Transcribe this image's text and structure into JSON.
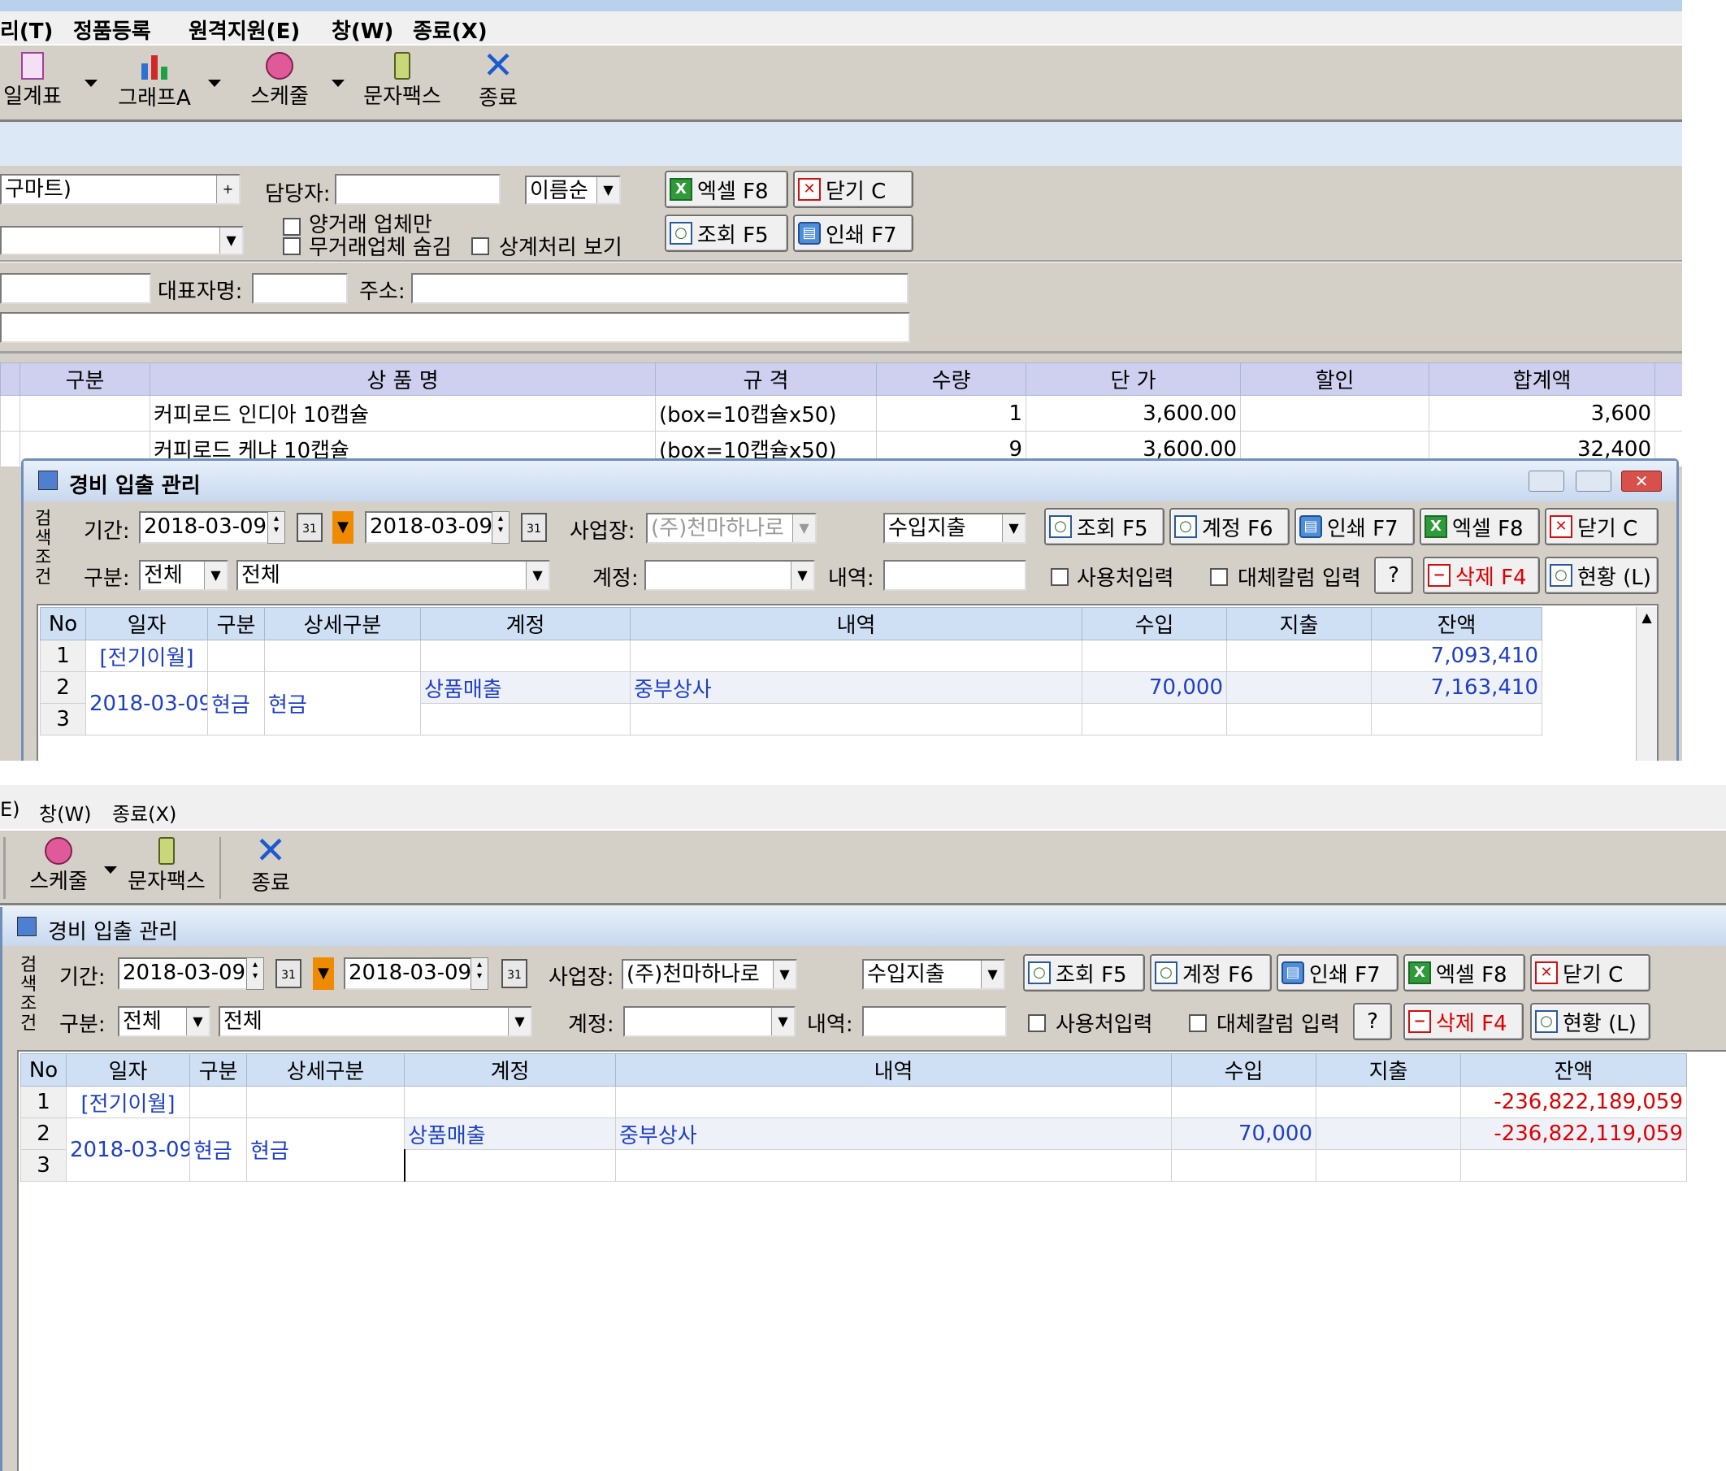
{
  "top": {
    "menu": [
      "리(T)",
      "정품등록",
      "원격지원(E)",
      "창(W)",
      "종료(X)"
    ],
    "toolbar": [
      {
        "label": "일계표",
        "icon": "ledger-icon"
      },
      {
        "label": "그래프A",
        "icon": "bar-chart-icon"
      },
      {
        "label": "스케줄",
        "icon": "clock-icon"
      },
      {
        "label": "문자팩스",
        "icon": "phone-icon"
      },
      {
        "label": "종료",
        "icon": "exit-x-icon"
      }
    ],
    "filter": {
      "store_value": "구마트)",
      "manager_label": "담당자:",
      "manager_value": "",
      "sort_value": "이름순",
      "only_traded_label": "양거래 업체만",
      "hide_untraded_label": "무거래업체 숨김",
      "offset_label": "상계처리 보기",
      "excel_btn": "엑셀 F8",
      "close_btn": "닫기 C",
      "search_btn": "조회 F5",
      "print_btn": "인쇄 F7",
      "rep_label": "대표자명:",
      "addr_label": "주소:"
    },
    "grid": {
      "headers": [
        "구분",
        "상 품 명",
        "규 격",
        "수량",
        "단 가",
        "할인",
        "합계액"
      ],
      "rows": [
        [
          "",
          "커피로드 인디아 10캡슐",
          "(box=10캡슐x50)",
          "1",
          "3,600.00",
          "",
          "3,600"
        ],
        [
          "",
          "커피로드 케냐 10캡슐",
          "(box=10캡슐x50)",
          "9",
          "3,600.00",
          "",
          "32,400"
        ]
      ]
    }
  },
  "dialog1": {
    "title": "경비 입출 관리",
    "side_label": "검색조건",
    "period_label": "기간:",
    "date_from": "2018-03-09",
    "date_to": "2018-03-09",
    "cal_label": "31",
    "biz_label": "사업장:",
    "biz_value": "(주)천마하나로",
    "io_value": "수입지출",
    "btn_search": "조회 F5",
    "btn_account": "계정 F6",
    "btn_print": "인쇄 F7",
    "btn_excel": "엑셀 F8",
    "btn_close": "닫기 C",
    "type_label": "구분:",
    "type_value": "전체",
    "type2_value": "전체",
    "acct_label": "계정:",
    "acct_value": "",
    "detail_label": "내역:",
    "detail_value": "",
    "use_label": "사용처입력",
    "alt_label": "대체칼럼 입력",
    "help_btn": "?",
    "btn_delete": "삭제 F4",
    "btn_status": "현황 (L)",
    "headers": [
      "No",
      "일자",
      "구분",
      "상세구분",
      "계정",
      "내역",
      "수입",
      "지출",
      "잔액"
    ],
    "rows": [
      {
        "no": "1",
        "date": "[전기이월]",
        "type": "",
        "sub": "",
        "acct": "",
        "detail": "",
        "in": "",
        "out": "",
        "bal": "7,093,410"
      },
      {
        "no": "2",
        "date": "2018-03-09",
        "type": "현금",
        "sub": "현금",
        "acct": "상품매출",
        "detail": "중부상사",
        "in": "70,000",
        "out": "",
        "bal": "7,163,410"
      },
      {
        "no": "3",
        "date": "",
        "type": "",
        "sub": "",
        "acct": "",
        "detail": "",
        "in": "",
        "out": "",
        "bal": ""
      }
    ]
  },
  "bottom": {
    "menu": [
      "E)",
      "창(W)",
      "종료(X)"
    ],
    "toolbar": [
      {
        "label": "스케줄",
        "icon": "clock-icon"
      },
      {
        "label": "문자팩스",
        "icon": "phone-icon"
      },
      {
        "label": "종료",
        "icon": "exit-x-icon"
      }
    ]
  },
  "dialog2": {
    "title": "경비 입출 관리",
    "side_label": "검색조건",
    "period_label": "기간:",
    "date_from": "2018-03-09",
    "date_to": "2018-03-09",
    "cal_label": "31",
    "biz_label": "사업장:",
    "biz_value": "(주)천마하나로",
    "io_value": "수입지출",
    "btn_search": "조회 F5",
    "btn_account": "계정 F6",
    "btn_print": "인쇄 F7",
    "btn_excel": "엑셀 F8",
    "btn_close": "닫기 C",
    "type_label": "구분:",
    "type_value": "전체",
    "type2_value": "전체",
    "acct_label": "계정:",
    "acct_value": "",
    "detail_label": "내역:",
    "detail_value": "",
    "use_label": "사용처입력",
    "alt_label": "대체칼럼 입력",
    "help_btn": "?",
    "btn_delete": "삭제 F4",
    "btn_status": "현황 (L)",
    "headers": [
      "No",
      "일자",
      "구분",
      "상세구분",
      "계정",
      "내역",
      "수입",
      "지출",
      "잔액"
    ],
    "rows": [
      {
        "no": "1",
        "date": "[전기이월]",
        "type": "",
        "sub": "",
        "acct": "",
        "detail": "",
        "in": "",
        "out": "",
        "bal": "-236,822,189,059"
      },
      {
        "no": "2",
        "date": "2018-03-09",
        "type": "현금",
        "sub": "현금",
        "acct": "상품매출",
        "detail": "중부상사",
        "in": "70,000",
        "out": "",
        "bal": "-236,822,119,059"
      },
      {
        "no": "3",
        "date": "",
        "type": "",
        "sub": "",
        "acct": "",
        "detail": "",
        "in": "",
        "out": "",
        "bal": ""
      }
    ]
  },
  "colors": {
    "header_blue": "#cfe0f4",
    "toolbar_gray": "#d4d0c8",
    "title_blue": "#dde8f6",
    "text_blue": "#1f3fc8",
    "negative_red": "#e00000",
    "accent_orange": "#f08a00"
  }
}
